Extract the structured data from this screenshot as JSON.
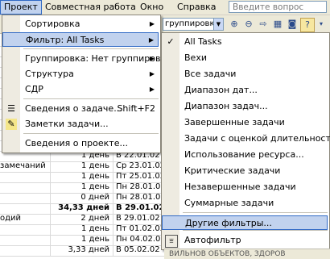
{
  "menubar": {
    "items": [
      "Проект",
      "Совместная работа",
      "Окно",
      "Справка"
    ],
    "question_placeholder": "Введите вопрос"
  },
  "toolbar": {
    "group_combo": "группировки"
  },
  "grid_rows": [
    {
      "name": "",
      "dur": "",
      "start": ""
    },
    {
      "name": "",
      "dur": "",
      "start": ""
    },
    {
      "name": "",
      "dur": "",
      "start": ""
    },
    {
      "name": "",
      "dur": "",
      "start": ""
    },
    {
      "name": "",
      "dur": "",
      "start": ""
    },
    {
      "name": "",
      "dur": "",
      "start": ""
    },
    {
      "name": "",
      "dur": "",
      "start": ""
    },
    {
      "name": "",
      "dur": "",
      "start": ""
    },
    {
      "name": "",
      "dur": "",
      "start": ""
    },
    {
      "name": "",
      "dur": "",
      "start": ""
    },
    {
      "name": "",
      "dur": "",
      "start": ""
    },
    {
      "name": "",
      "dur": "1 день",
      "start": "В 22.01.02"
    },
    {
      "name": "замечаний",
      "dur": "1 день",
      "start": "Ср 23.01.02"
    },
    {
      "name": "",
      "dur": "1 день",
      "start": "Пт 25.01.02"
    },
    {
      "name": "",
      "dur": "1 день",
      "start": "Пн 28.01.02"
    },
    {
      "name": "",
      "dur": "0 дней",
      "start": "Пн 28.01.02"
    },
    {
      "name": "",
      "dur": "34,33 дней",
      "start": "В 29.01.02",
      "bold": true
    },
    {
      "name": "одий",
      "dur": "2 дней",
      "start": "В 29.01.02"
    },
    {
      "name": "",
      "dur": "1 день",
      "start": "Пт 01.02.02"
    },
    {
      "name": "",
      "dur": "1 день",
      "start": "Пн 04.02.02"
    },
    {
      "name": "",
      "dur": "3,33 дней",
      "start": "В 05.02.02"
    }
  ],
  "project_menu": {
    "items": [
      {
        "label": "Сортировка",
        "submenu": true
      },
      {
        "label": "Фильтр: All Tasks",
        "submenu": true,
        "highlighted": true
      },
      {
        "label": "Группировка: Нет группировки",
        "submenu": true
      },
      {
        "label": "Структура",
        "submenu": true
      },
      {
        "label": "СДР",
        "submenu": true
      },
      {
        "label": "Сведения о задаче...",
        "shortcut": "Shift+F2",
        "icon": "task-info-icon"
      },
      {
        "label": "Заметки задачи...",
        "icon": "task-notes-icon"
      },
      {
        "label": "Сведения о проекте..."
      }
    ]
  },
  "filter_menu": {
    "items": [
      {
        "label": "All Tasks",
        "checked": true
      },
      {
        "label": "Вехи"
      },
      {
        "label": "Все задачи"
      },
      {
        "label": "Диапазон дат..."
      },
      {
        "label": "Диапазон задач..."
      },
      {
        "label": "Завершенные задачи"
      },
      {
        "label": "Задачи с оценкой длительности"
      },
      {
        "label": "Использование ресурса..."
      },
      {
        "label": "Критические задачи"
      },
      {
        "label": "Незавершенные задачи"
      },
      {
        "label": "Суммарные задачи"
      },
      {
        "label": "Другие фильтры...",
        "highlighted": true
      },
      {
        "label": "Автофильтр",
        "icon": "autofilter-icon"
      }
    ]
  },
  "footer": {
    "text": "ВИЛЬНОВ ОБЪЕКТОВ, ЗДОРОВ"
  },
  "colors": {
    "menu_highlight": "#c1d2ee",
    "highlight_border": "#316ac5",
    "menubar_bg": "#ece9d8"
  }
}
